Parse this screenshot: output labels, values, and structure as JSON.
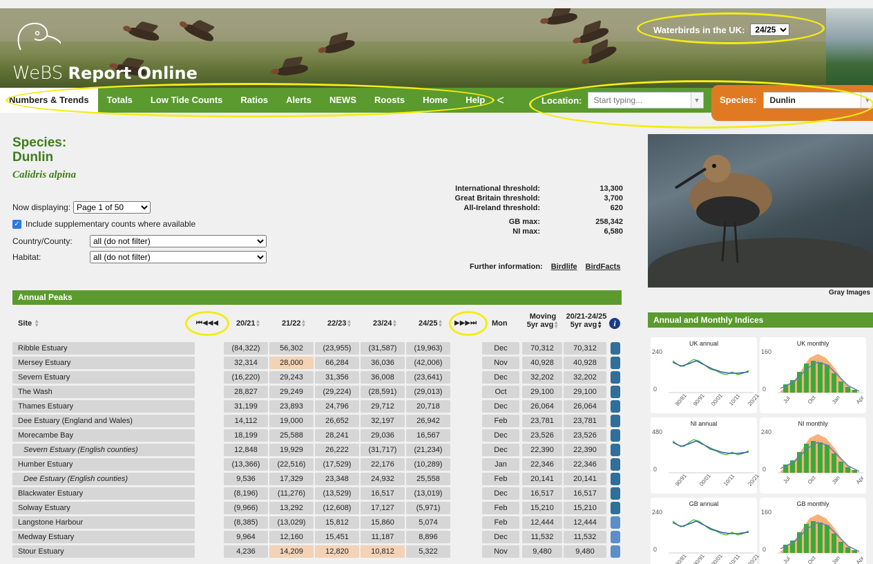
{
  "header": {
    "logo_webs": "WeBS",
    "logo_title": "Report Online",
    "waterbirds_label": "Waterbirds in the UK:",
    "season_selected": "24/25"
  },
  "nav": {
    "items": [
      "Numbers & Trends",
      "Totals",
      "Low Tide Counts",
      "Ratios",
      "Alerts",
      "NEWS",
      "Roosts",
      "Home",
      "Help"
    ],
    "location_label": "Location:",
    "location_placeholder": "Start typing...",
    "species_label": "Species:",
    "species_value": "Dunlin"
  },
  "species": {
    "heading": "Species:",
    "name": "Dunlin",
    "latin": "Calidris alpina"
  },
  "filters": {
    "now_displaying_label": "Now displaying:",
    "now_displaying_value": "Page 1 of 50",
    "supplementary_label": "Include supplementary counts where available",
    "country_label": "Country/County:",
    "country_value": "all (do not filter)",
    "habitat_label": "Habitat:",
    "habitat_value": "all (do not filter)"
  },
  "thresholds": [
    {
      "label": "International threshold:",
      "value": "13,300"
    },
    {
      "label": "Great Britain threshold:",
      "value": "3,700"
    },
    {
      "label": "All-Ireland threshold:",
      "value": "620"
    },
    {
      "label": "GB max:",
      "value": "258,342"
    },
    {
      "label": "NI max:",
      "value": "6,580"
    }
  ],
  "further": {
    "label": "Further information:",
    "links": [
      "Birdlife",
      "BirdFacts"
    ]
  },
  "table": {
    "title": "Annual Peaks",
    "columns": {
      "site": "Site",
      "first_icons": "⏮◀◀◀",
      "y1": "20/21",
      "y2": "21/22",
      "y3": "22/23",
      "y4": "23/24",
      "y5": "24/25",
      "last_icons": "▶▶▶⏭",
      "mon": "Mon",
      "moving_top": "Moving",
      "moving_bottom": "5yr avg",
      "range_top": "20/21-24/25",
      "range_bottom": "5yr avg",
      "info": "i"
    },
    "rows": [
      {
        "site": "Ribble Estuary",
        "sub": false,
        "v": [
          "(84,322)",
          "56,302",
          "(23,955)",
          "(31,587)",
          "(19,963)"
        ],
        "hl": [],
        "mon": "Dec",
        "mov": "70,312",
        "avg": "70,312",
        "bar": "dark"
      },
      {
        "site": "Mersey Estuary",
        "sub": false,
        "v": [
          "32,314",
          "28,000",
          "66,284",
          "36,036",
          "(42,006)"
        ],
        "hl": [
          1
        ],
        "mon": "Nov",
        "mov": "40,928",
        "avg": "40,928",
        "bar": "dark"
      },
      {
        "site": "Severn Estuary",
        "sub": false,
        "v": [
          "(16,220)",
          "29,243",
          "31,356",
          "36,008",
          "(23,641)"
        ],
        "hl": [],
        "mon": "Dec",
        "mov": "32,202",
        "avg": "32,202",
        "bar": "dark"
      },
      {
        "site": "The Wash",
        "sub": false,
        "v": [
          "28,827",
          "29,249",
          "(29,224)",
          "(28,591)",
          "(29,013)"
        ],
        "hl": [],
        "mon": "Oct",
        "mov": "29,100",
        "avg": "29,100",
        "bar": "dark"
      },
      {
        "site": "Thames Estuary",
        "sub": false,
        "v": [
          "31,199",
          "23,893",
          "24,796",
          "29,712",
          "20,718"
        ],
        "hl": [],
        "mon": "Dec",
        "mov": "26,064",
        "avg": "26,064",
        "bar": "dark"
      },
      {
        "site": "Dee Estuary (England and Wales)",
        "sub": false,
        "v": [
          "14,112",
          "19,000",
          "26,652",
          "32,197",
          "26,942"
        ],
        "hl": [],
        "mon": "Feb",
        "mov": "23,781",
        "avg": "23,781",
        "bar": "dark"
      },
      {
        "site": "Morecambe Bay",
        "sub": false,
        "v": [
          "18,199",
          "25,588",
          "28,241",
          "29,036",
          "16,567"
        ],
        "hl": [],
        "mon": "Dec",
        "mov": "23,526",
        "avg": "23,526",
        "bar": "dark"
      },
      {
        "site": "Severn Estuary (English counties)",
        "sub": true,
        "v": [
          "12,848",
          "19,929",
          "26,222",
          "(31,717)",
          "(21,234)"
        ],
        "hl": [],
        "mon": "Dec",
        "mov": "22,390",
        "avg": "22,390",
        "bar": "dark"
      },
      {
        "site": "Humber Estuary",
        "sub": false,
        "v": [
          "(13,366)",
          "(22,516)",
          "(17,529)",
          "22,176",
          "(10,289)"
        ],
        "hl": [],
        "mon": "Jan",
        "mov": "22,346",
        "avg": "22,346",
        "bar": "dark"
      },
      {
        "site": "Dee Estuary (English counties)",
        "sub": true,
        "v": [
          "9,536",
          "17,329",
          "23,348",
          "24,932",
          "25,558"
        ],
        "hl": [],
        "mon": "Feb",
        "mov": "20,141",
        "avg": "20,141",
        "bar": "dark"
      },
      {
        "site": "Blackwater Estuary",
        "sub": false,
        "v": [
          "(8,196)",
          "(11,276)",
          "(13,529)",
          "16,517",
          "(13,019)"
        ],
        "hl": [],
        "mon": "Dec",
        "mov": "16,517",
        "avg": "16,517",
        "bar": "dark"
      },
      {
        "site": "Solway Estuary",
        "sub": false,
        "v": [
          "(9,966)",
          "13,292",
          "(12,608)",
          "17,127",
          "(5,971)"
        ],
        "hl": [],
        "mon": "Feb",
        "mov": "15,210",
        "avg": "15,210",
        "bar": "dark"
      },
      {
        "site": "Langstone Harbour",
        "sub": false,
        "v": [
          "(8,385)",
          "(13,029)",
          "15,812",
          "15,860",
          "5,074"
        ],
        "hl": [],
        "mon": "Feb",
        "mov": "12,444",
        "avg": "12,444",
        "bar": "light"
      },
      {
        "site": "Medway Estuary",
        "sub": false,
        "v": [
          "9,964",
          "12,160",
          "15,451",
          "11,187",
          "8,896"
        ],
        "hl": [],
        "mon": "Dec",
        "mov": "11,532",
        "avg": "11,532",
        "bar": "light"
      },
      {
        "site": "Stour Estuary",
        "sub": false,
        "v": [
          "4,236",
          "14,209",
          "12,820",
          "10,812",
          "5,322"
        ],
        "hl": [
          1,
          2,
          3
        ],
        "mon": "Nov",
        "mov": "9,480",
        "avg": "9,480",
        "bar": "light"
      }
    ]
  },
  "photo_credit": "Gray Images",
  "indices": {
    "title": "Annual and Monthly Indices",
    "charts": [
      {
        "title": "UK annual",
        "ymax": "240",
        "yzero": "0",
        "ticks": [
          "80/81",
          "90/91",
          "00/01",
          "10/11",
          "20/21"
        ]
      },
      {
        "title": "UK monthly",
        "ymax": "160",
        "yzero": "0",
        "ticks": [
          "Jul",
          "Oct",
          "Jan",
          "Apr"
        ]
      },
      {
        "title": "NI annual",
        "ymax": "480",
        "yzero": "0",
        "ticks": [
          "90/91",
          "00/01",
          "10/11",
          "20/21"
        ]
      },
      {
        "title": "NI monthly",
        "ymax": "240",
        "yzero": "0",
        "ticks": [
          "Jul",
          "Oct",
          "Jan",
          "Apr"
        ]
      },
      {
        "title": "GB annual",
        "ymax": "240",
        "yzero": "0",
        "ticks": [
          "80/81",
          "90/91",
          "00/01",
          "10/11",
          "20/21"
        ]
      },
      {
        "title": "GB monthly",
        "ymax": "160",
        "yzero": "0",
        "ticks": [
          "Jul",
          "Oct",
          "Jan",
          "Apr"
        ]
      }
    ]
  },
  "colors": {
    "nav_green": "#5a9a2e",
    "species_orange": "#e07a22",
    "highlight": "#f3d2b6",
    "heading_green": "#3d7d1a"
  }
}
